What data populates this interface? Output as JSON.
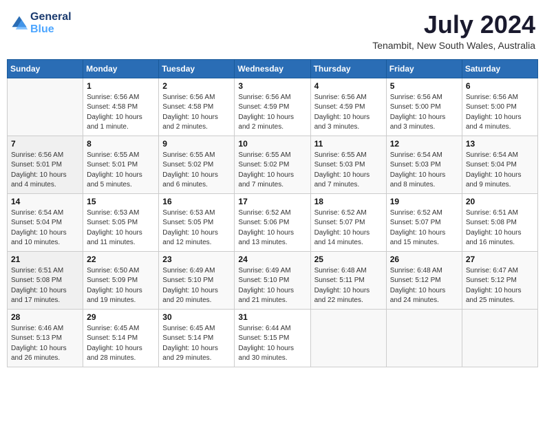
{
  "header": {
    "logo_line1": "General",
    "logo_line2": "Blue",
    "month": "July 2024",
    "location": "Tenambit, New South Wales, Australia"
  },
  "days_of_week": [
    "Sunday",
    "Monday",
    "Tuesday",
    "Wednesday",
    "Thursday",
    "Friday",
    "Saturday"
  ],
  "weeks": [
    [
      {
        "day": "",
        "info": ""
      },
      {
        "day": "1",
        "info": "Sunrise: 6:56 AM\nSunset: 4:58 PM\nDaylight: 10 hours\nand 1 minute."
      },
      {
        "day": "2",
        "info": "Sunrise: 6:56 AM\nSunset: 4:58 PM\nDaylight: 10 hours\nand 2 minutes."
      },
      {
        "day": "3",
        "info": "Sunrise: 6:56 AM\nSunset: 4:59 PM\nDaylight: 10 hours\nand 2 minutes."
      },
      {
        "day": "4",
        "info": "Sunrise: 6:56 AM\nSunset: 4:59 PM\nDaylight: 10 hours\nand 3 minutes."
      },
      {
        "day": "5",
        "info": "Sunrise: 6:56 AM\nSunset: 5:00 PM\nDaylight: 10 hours\nand 3 minutes."
      },
      {
        "day": "6",
        "info": "Sunrise: 6:56 AM\nSunset: 5:00 PM\nDaylight: 10 hours\nand 4 minutes."
      }
    ],
    [
      {
        "day": "7",
        "info": "Sunrise: 6:56 AM\nSunset: 5:01 PM\nDaylight: 10 hours\nand 4 minutes."
      },
      {
        "day": "8",
        "info": "Sunrise: 6:55 AM\nSunset: 5:01 PM\nDaylight: 10 hours\nand 5 minutes."
      },
      {
        "day": "9",
        "info": "Sunrise: 6:55 AM\nSunset: 5:02 PM\nDaylight: 10 hours\nand 6 minutes."
      },
      {
        "day": "10",
        "info": "Sunrise: 6:55 AM\nSunset: 5:02 PM\nDaylight: 10 hours\nand 7 minutes."
      },
      {
        "day": "11",
        "info": "Sunrise: 6:55 AM\nSunset: 5:03 PM\nDaylight: 10 hours\nand 7 minutes."
      },
      {
        "day": "12",
        "info": "Sunrise: 6:54 AM\nSunset: 5:03 PM\nDaylight: 10 hours\nand 8 minutes."
      },
      {
        "day": "13",
        "info": "Sunrise: 6:54 AM\nSunset: 5:04 PM\nDaylight: 10 hours\nand 9 minutes."
      }
    ],
    [
      {
        "day": "14",
        "info": "Sunrise: 6:54 AM\nSunset: 5:04 PM\nDaylight: 10 hours\nand 10 minutes."
      },
      {
        "day": "15",
        "info": "Sunrise: 6:53 AM\nSunset: 5:05 PM\nDaylight: 10 hours\nand 11 minutes."
      },
      {
        "day": "16",
        "info": "Sunrise: 6:53 AM\nSunset: 5:05 PM\nDaylight: 10 hours\nand 12 minutes."
      },
      {
        "day": "17",
        "info": "Sunrise: 6:52 AM\nSunset: 5:06 PM\nDaylight: 10 hours\nand 13 minutes."
      },
      {
        "day": "18",
        "info": "Sunrise: 6:52 AM\nSunset: 5:07 PM\nDaylight: 10 hours\nand 14 minutes."
      },
      {
        "day": "19",
        "info": "Sunrise: 6:52 AM\nSunset: 5:07 PM\nDaylight: 10 hours\nand 15 minutes."
      },
      {
        "day": "20",
        "info": "Sunrise: 6:51 AM\nSunset: 5:08 PM\nDaylight: 10 hours\nand 16 minutes."
      }
    ],
    [
      {
        "day": "21",
        "info": "Sunrise: 6:51 AM\nSunset: 5:08 PM\nDaylight: 10 hours\nand 17 minutes."
      },
      {
        "day": "22",
        "info": "Sunrise: 6:50 AM\nSunset: 5:09 PM\nDaylight: 10 hours\nand 19 minutes."
      },
      {
        "day": "23",
        "info": "Sunrise: 6:49 AM\nSunset: 5:10 PM\nDaylight: 10 hours\nand 20 minutes."
      },
      {
        "day": "24",
        "info": "Sunrise: 6:49 AM\nSunset: 5:10 PM\nDaylight: 10 hours\nand 21 minutes."
      },
      {
        "day": "25",
        "info": "Sunrise: 6:48 AM\nSunset: 5:11 PM\nDaylight: 10 hours\nand 22 minutes."
      },
      {
        "day": "26",
        "info": "Sunrise: 6:48 AM\nSunset: 5:12 PM\nDaylight: 10 hours\nand 24 minutes."
      },
      {
        "day": "27",
        "info": "Sunrise: 6:47 AM\nSunset: 5:12 PM\nDaylight: 10 hours\nand 25 minutes."
      }
    ],
    [
      {
        "day": "28",
        "info": "Sunrise: 6:46 AM\nSunset: 5:13 PM\nDaylight: 10 hours\nand 26 minutes."
      },
      {
        "day": "29",
        "info": "Sunrise: 6:45 AM\nSunset: 5:14 PM\nDaylight: 10 hours\nand 28 minutes."
      },
      {
        "day": "30",
        "info": "Sunrise: 6:45 AM\nSunset: 5:14 PM\nDaylight: 10 hours\nand 29 minutes."
      },
      {
        "day": "31",
        "info": "Sunrise: 6:44 AM\nSunset: 5:15 PM\nDaylight: 10 hours\nand 30 minutes."
      },
      {
        "day": "",
        "info": ""
      },
      {
        "day": "",
        "info": ""
      },
      {
        "day": "",
        "info": ""
      }
    ]
  ]
}
